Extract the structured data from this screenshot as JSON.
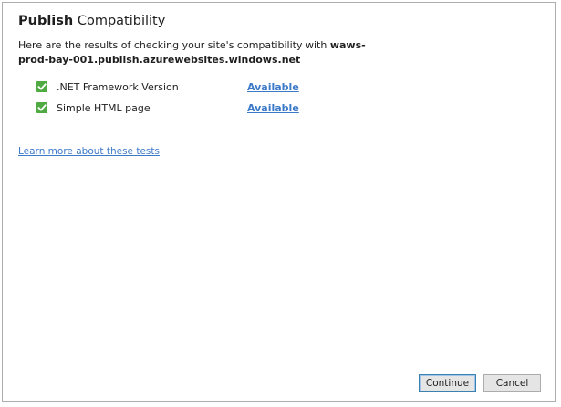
{
  "dialog": {
    "title_bold": "Publish",
    "title_rest": " Compatibility",
    "intro_text": "Here are the results of checking your site's compatibility with ",
    "host": "waws-prod-bay-001.publish.azurewebsites.windows.net",
    "results": [
      {
        "label": ".NET Framework Version",
        "status": "Available",
        "icon": "checkmark-icon",
        "color": "#4faa42"
      },
      {
        "label": "Simple HTML page",
        "status": "Available",
        "icon": "checkmark-icon",
        "color": "#4faa42"
      }
    ],
    "learn_more": "Learn more about these tests",
    "continue_label": "Continue",
    "cancel_label": "Cancel"
  },
  "colors": {
    "link": "#3b79c9",
    "success": "#4faa42"
  }
}
